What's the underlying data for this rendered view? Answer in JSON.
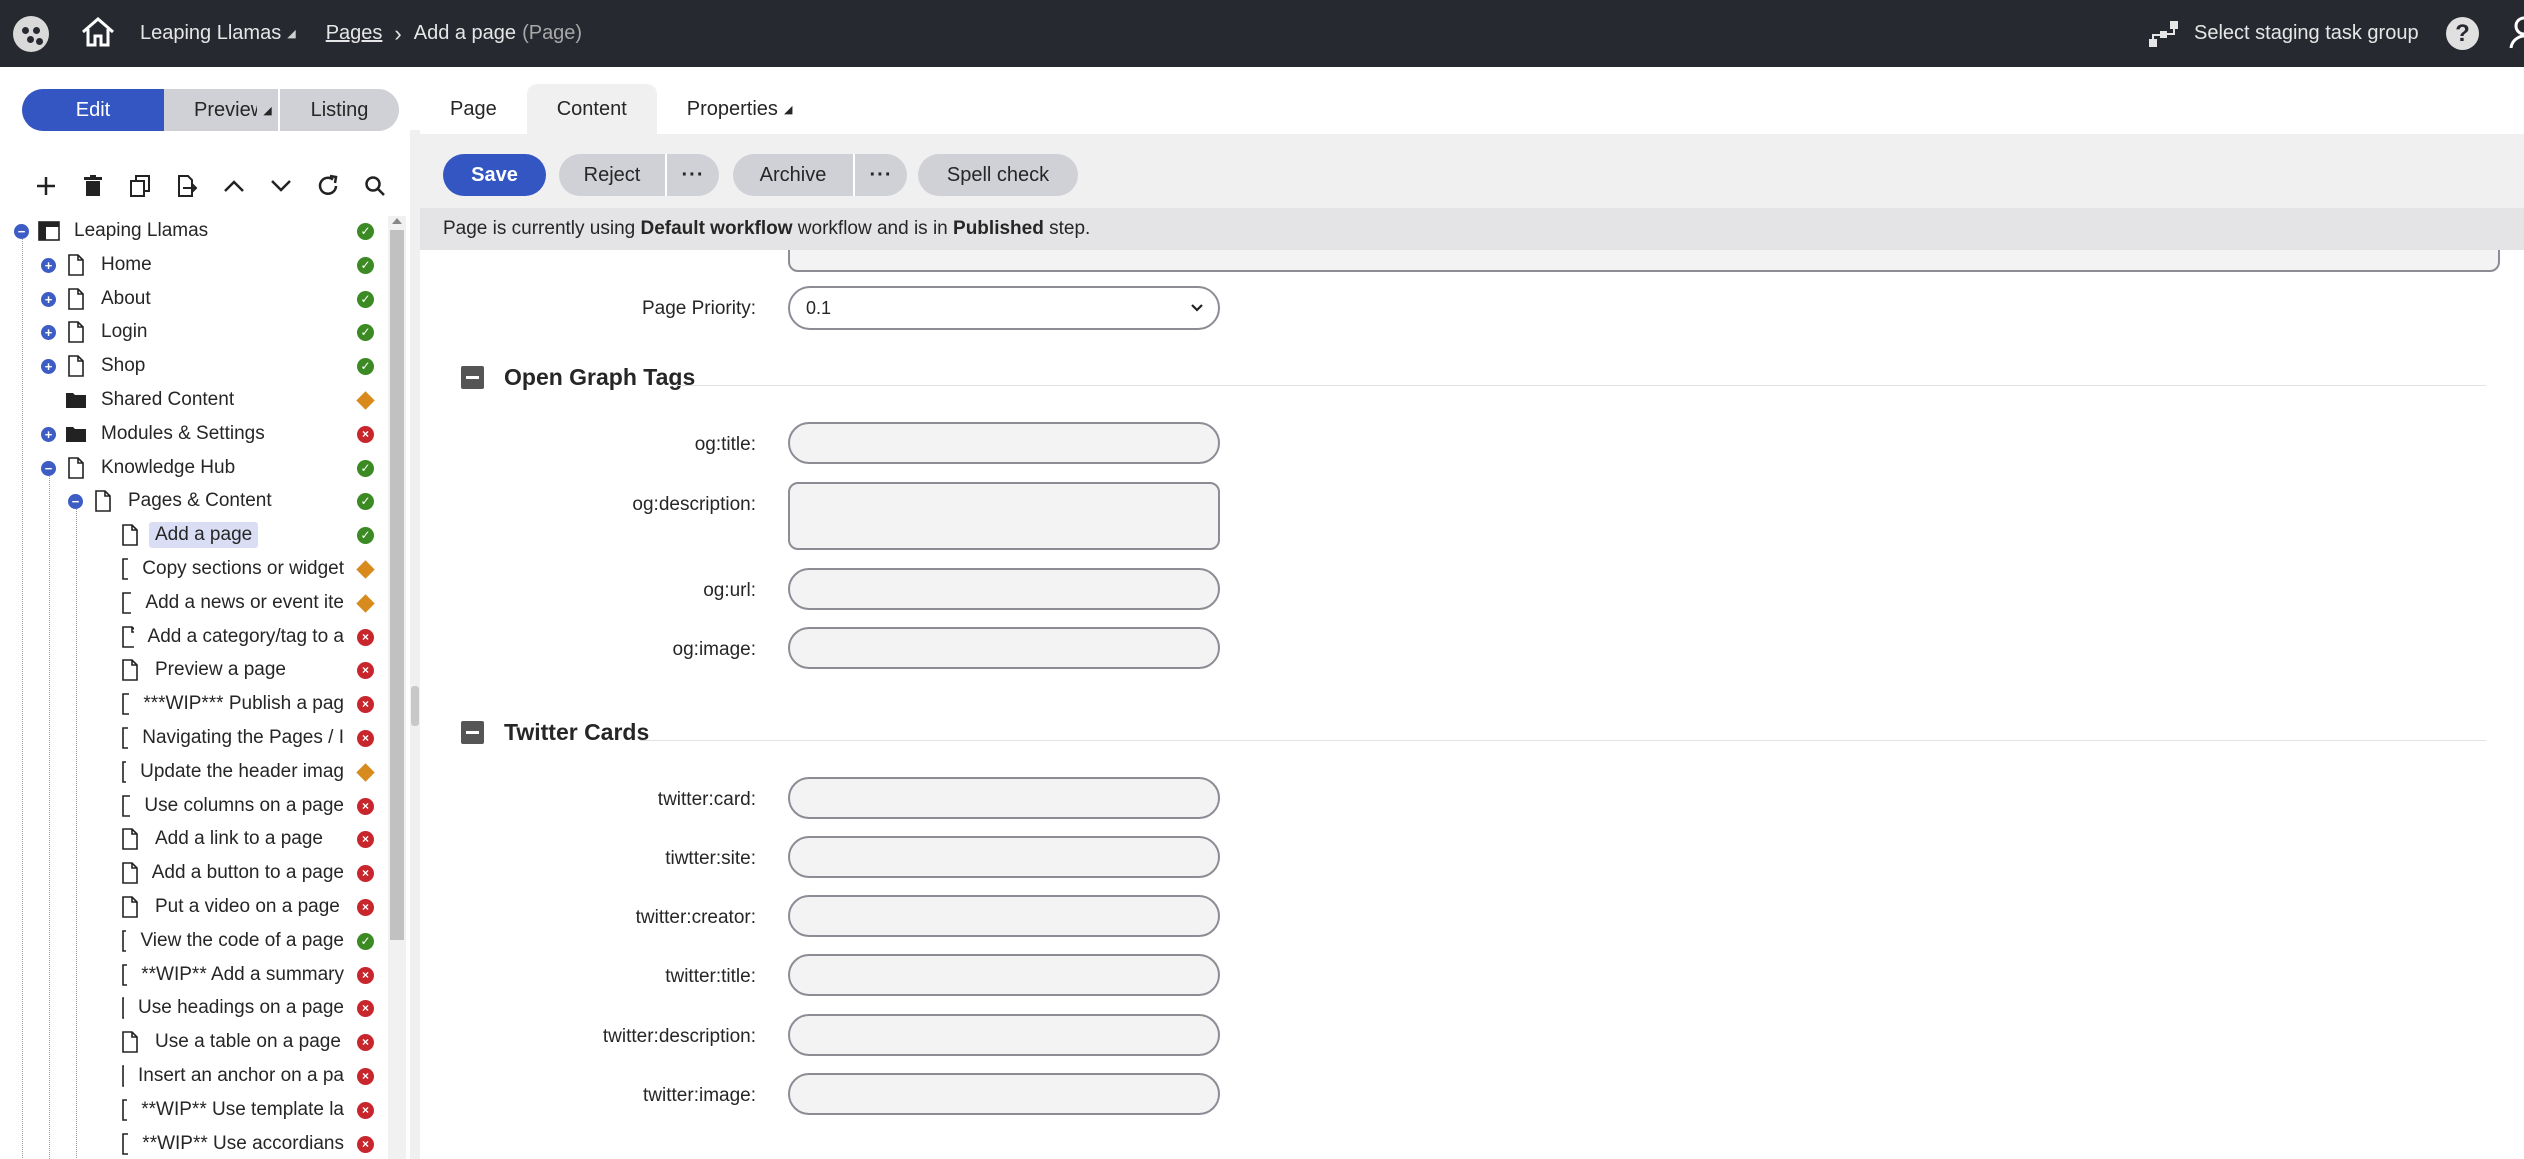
{
  "topbar": {
    "site": "Leaping Llamas",
    "breadcrumb_link": "Pages",
    "breadcrumb_current": "Add a page",
    "breadcrumb_type": "(Page)",
    "staging_label": "Select staging task group",
    "help_label": "?"
  },
  "modes": {
    "edit": "Edit",
    "preview": "Preview",
    "listing": "Listing"
  },
  "tabs": {
    "page": "Page",
    "content": "Content",
    "properties": "Properties"
  },
  "tree_tools": [
    "add-icon",
    "delete-icon",
    "copy-icon",
    "move-icon",
    "move-up-icon",
    "move-down-icon",
    "refresh-icon",
    "search-icon"
  ],
  "tree": [
    {
      "label": "Leaping Llamas",
      "level": 0,
      "toggle": "minus",
      "icon": "site",
      "status": "ok"
    },
    {
      "label": "Home",
      "level": 1,
      "toggle": "plus",
      "icon": "page",
      "status": "ok"
    },
    {
      "label": "About",
      "level": 1,
      "toggle": "plus",
      "icon": "page",
      "status": "ok"
    },
    {
      "label": "Login",
      "level": 1,
      "toggle": "plus",
      "icon": "page",
      "status": "ok"
    },
    {
      "label": "Shop",
      "level": 1,
      "toggle": "plus",
      "icon": "page",
      "status": "ok"
    },
    {
      "label": "Shared Content",
      "level": 1,
      "toggle": "",
      "icon": "folder",
      "status": "pend"
    },
    {
      "label": "Modules & Settings",
      "level": 1,
      "toggle": "plus",
      "icon": "folder",
      "status": "err"
    },
    {
      "label": "Knowledge Hub",
      "level": 1,
      "toggle": "minus",
      "icon": "page",
      "status": "ok"
    },
    {
      "label": "Pages & Content",
      "level": 2,
      "toggle": "minus",
      "icon": "page",
      "status": "ok"
    },
    {
      "label": "Add a page",
      "level": 3,
      "toggle": "",
      "icon": "page",
      "status": "ok",
      "selected": true
    },
    {
      "label": "Copy sections or widget",
      "level": 3,
      "toggle": "",
      "icon": "page",
      "status": "pend"
    },
    {
      "label": "Add a news or event ite",
      "level": 3,
      "toggle": "",
      "icon": "page",
      "status": "pend"
    },
    {
      "label": "Add a category/tag to a",
      "level": 3,
      "toggle": "",
      "icon": "page",
      "status": "err"
    },
    {
      "label": "Preview a page",
      "level": 3,
      "toggle": "",
      "icon": "page",
      "status": "err"
    },
    {
      "label": "***WIP*** Publish a pag",
      "level": 3,
      "toggle": "",
      "icon": "page",
      "status": "err"
    },
    {
      "label": "Navigating the Pages / I",
      "level": 3,
      "toggle": "",
      "icon": "page",
      "status": "err"
    },
    {
      "label": "Update the header imag",
      "level": 3,
      "toggle": "",
      "icon": "page",
      "status": "pend"
    },
    {
      "label": "Use columns on a page",
      "level": 3,
      "toggle": "",
      "icon": "page",
      "status": "err"
    },
    {
      "label": "Add a link to a page",
      "level": 3,
      "toggle": "",
      "icon": "page",
      "status": "err"
    },
    {
      "label": "Add a button to a page",
      "level": 3,
      "toggle": "",
      "icon": "page",
      "status": "err"
    },
    {
      "label": "Put a video on a page",
      "level": 3,
      "toggle": "",
      "icon": "page",
      "status": "err"
    },
    {
      "label": "View the code of a page",
      "level": 3,
      "toggle": "",
      "icon": "page",
      "status": "ok"
    },
    {
      "label": "**WIP** Add a summary",
      "level": 3,
      "toggle": "",
      "icon": "page",
      "status": "err"
    },
    {
      "label": "Use headings on a page",
      "level": 3,
      "toggle": "",
      "icon": "page",
      "status": "err"
    },
    {
      "label": "Use a table on a page",
      "level": 3,
      "toggle": "",
      "icon": "page",
      "status": "err"
    },
    {
      "label": "Insert an anchor on a pa",
      "level": 3,
      "toggle": "",
      "icon": "page",
      "status": "err"
    },
    {
      "label": "**WIP** Use template la",
      "level": 3,
      "toggle": "",
      "icon": "page",
      "status": "err"
    },
    {
      "label": "**WIP** Use accordians",
      "level": 3,
      "toggle": "",
      "icon": "page",
      "status": "err"
    }
  ],
  "actions": {
    "save": "Save",
    "reject": "Reject",
    "archive": "Archive",
    "spell_check": "Spell check",
    "more": "···"
  },
  "workflow_notice": {
    "prefix": "Page is currently using ",
    "workflow": "Default workflow",
    "middle": " workflow and is in ",
    "step": "Published",
    "suffix": " step."
  },
  "form": {
    "priority_label": "Page Priority:",
    "priority_value": "0.1",
    "og_section": "Open Graph Tags",
    "og_title": "og:title:",
    "og_description": "og:description:",
    "og_url": "og:url:",
    "og_image": "og:image:",
    "twitter_section": "Twitter Cards",
    "twitter_card": "twitter:card:",
    "twitter_site": "tiwtter:site:",
    "twitter_creator": "twitter:creator:",
    "twitter_title": "twitter:title:",
    "twitter_description": "twitter:description:",
    "twitter_image": "twitter:image:"
  },
  "colors": {
    "topbar": "#262a30",
    "primary": "#3356c2",
    "status_ok": "#3b8a23",
    "status_err": "#c8262d",
    "status_pending": "#d98a1c"
  }
}
